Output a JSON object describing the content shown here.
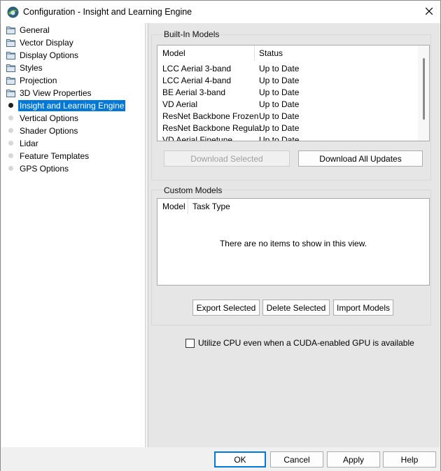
{
  "window": {
    "title": "Configuration - Insight and Learning Engine",
    "icons": {
      "app": "app-logo-icon",
      "close": "close-icon"
    }
  },
  "nav": {
    "items": [
      {
        "label": "General",
        "icon": "folder-icon"
      },
      {
        "label": "Vector Display",
        "icon": "folder-icon"
      },
      {
        "label": "Display Options",
        "icon": "folder-icon"
      },
      {
        "label": "Styles",
        "icon": "folder-icon"
      },
      {
        "label": "Projection",
        "icon": "folder-icon"
      },
      {
        "label": "3D View Properties",
        "icon": "folder-icon"
      },
      {
        "label": "Insight and Learning Engine",
        "icon": "bullet-icon",
        "selected": true
      },
      {
        "label": "Vertical Options",
        "icon": "bullet-icon"
      },
      {
        "label": "Shader Options",
        "icon": "bullet-icon"
      },
      {
        "label": "Lidar",
        "icon": "bullet-icon"
      },
      {
        "label": "Feature Templates",
        "icon": "bullet-icon"
      },
      {
        "label": "GPS Options",
        "icon": "bullet-icon"
      }
    ]
  },
  "builtin": {
    "group_label": "Built-In Models",
    "columns": [
      "Model",
      "Status"
    ],
    "rows": [
      [
        "LCC Aerial 3-band",
        "Up to Date"
      ],
      [
        "LCC Aerial 4-band",
        "Up to Date"
      ],
      [
        "BE Aerial 3-band",
        "Up to Date"
      ],
      [
        "VD Aerial",
        "Up to Date"
      ],
      [
        "ResNet Backbone Frozen",
        "Up to Date"
      ],
      [
        "ResNet Backbone Regular",
        "Up to Date"
      ],
      [
        "VD Aerial Finetune",
        "Up to Date"
      ]
    ],
    "download_selected": "Download Selected",
    "download_all": "Download All Updates"
  },
  "custom": {
    "group_label": "Custom Models",
    "columns": [
      "Model",
      "Task Type"
    ],
    "empty_message": "There are no items to show in this view.",
    "export": "Export Selected",
    "delete": "Delete Selected",
    "import": "Import Models"
  },
  "cpu_checkbox": {
    "label": "Utilize CPU even when a CUDA-enabled GPU is available",
    "checked": false
  },
  "footer": {
    "ok": "OK",
    "cancel": "Cancel",
    "apply": "Apply",
    "help": "Help"
  }
}
